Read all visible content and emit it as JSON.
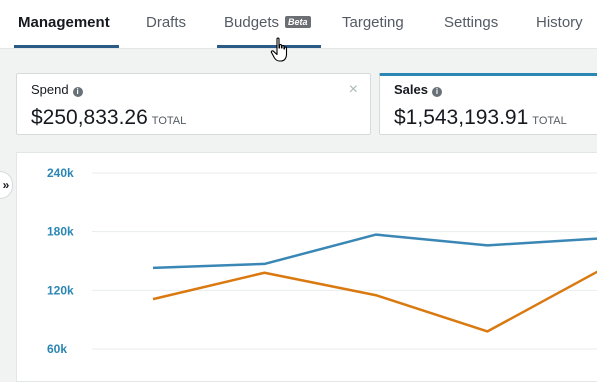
{
  "tabs": [
    {
      "label": "Management",
      "active": true
    },
    {
      "label": "Drafts"
    },
    {
      "label": "Budgets",
      "badge": "Beta"
    },
    {
      "label": "Targeting"
    },
    {
      "label": "Settings"
    },
    {
      "label": "History"
    }
  ],
  "metrics": [
    {
      "label": "Spend",
      "value": "$250,833.26",
      "suffix": "TOTAL",
      "close": "×"
    },
    {
      "label": "Sales",
      "value": "$1,543,193.91",
      "suffix": "TOTAL"
    }
  ],
  "sidebar": {
    "expand_icon": "»"
  },
  "colors": {
    "accent": "#2a5a86",
    "series_blue": "#3a87b5",
    "series_orange": "#d9790f"
  },
  "chart_data": {
    "type": "line",
    "y_ticks": [
      "240k",
      "180k",
      "120k",
      "60k"
    ],
    "ylim": [
      60000,
      240000
    ],
    "x": [
      1,
      2,
      3,
      4,
      5
    ],
    "series": [
      {
        "color": "#3a87b5",
        "values": [
          143000,
          147000,
          177000,
          166000,
          173000
        ]
      },
      {
        "color": "#d9790f",
        "values": [
          111000,
          138000,
          115000,
          78000,
          140000
        ]
      }
    ]
  }
}
